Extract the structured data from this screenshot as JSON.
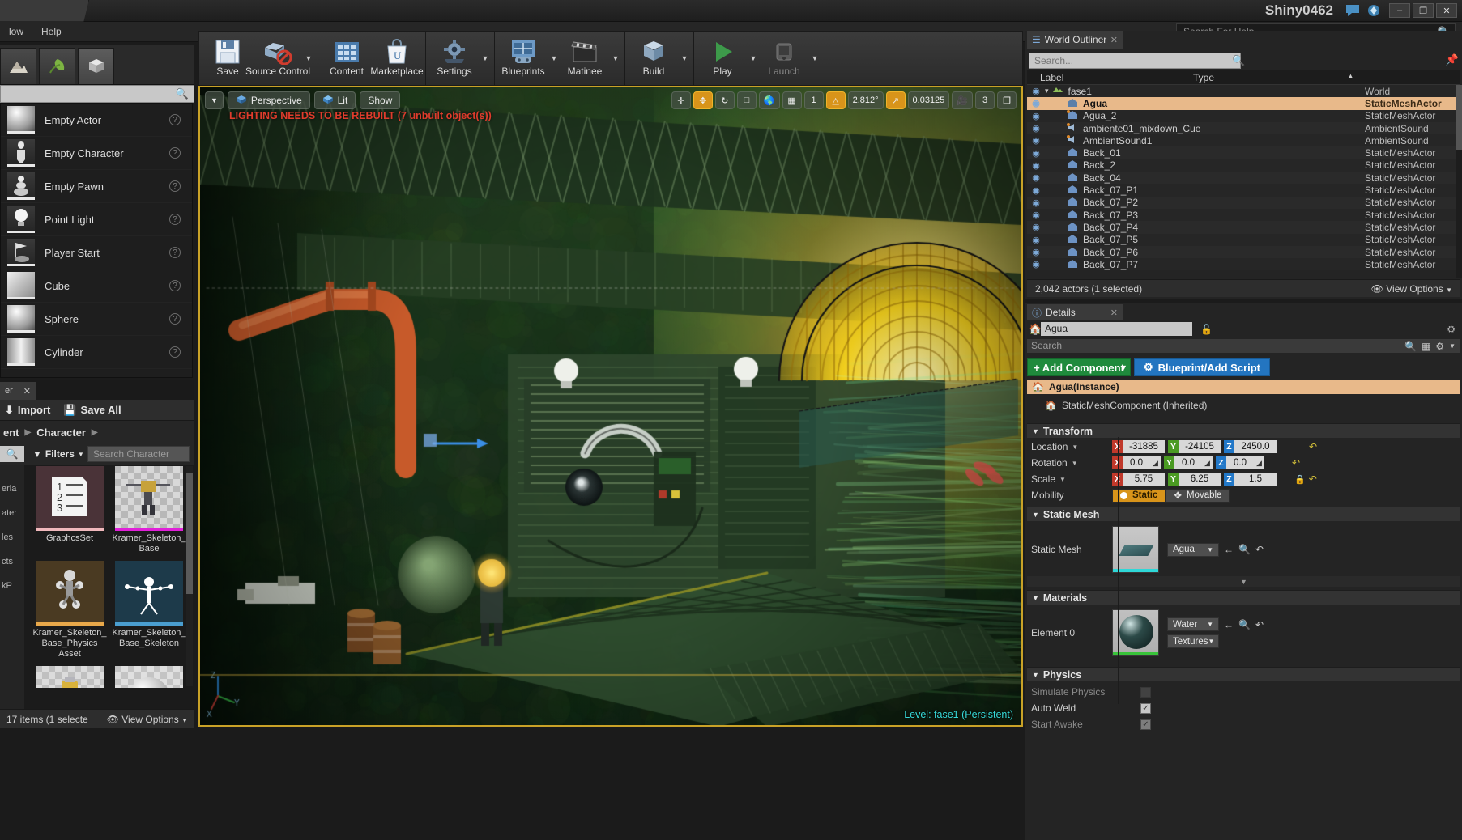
{
  "titlebar": {
    "tab_label": "",
    "project_title": "Shiny0462",
    "minimize": "–",
    "maximize": "❐",
    "close": "✕"
  },
  "menubar": {
    "items": [
      "low",
      "Help"
    ],
    "help_search_placeholder": "Search For Help"
  },
  "modes": {
    "search_placeholder": "",
    "place_items": [
      {
        "label": "Empty Actor",
        "icon": "sphere-icon"
      },
      {
        "label": "Empty Character",
        "icon": "character-icon"
      },
      {
        "label": "Empty Pawn",
        "icon": "pawn-icon"
      },
      {
        "label": "Point Light",
        "icon": "bulb-icon"
      },
      {
        "label": "Player Start",
        "icon": "flag-icon"
      },
      {
        "label": "Cube",
        "icon": "cube-icon"
      },
      {
        "label": "Sphere",
        "icon": "sphere-icon"
      },
      {
        "label": "Cylinder",
        "icon": "cylinder-icon"
      }
    ]
  },
  "content_browser": {
    "tab_label": "er",
    "tab_close": "✕",
    "import_label": "Import",
    "save_all_label": "Save All",
    "breadcrumb": [
      "ent",
      "Character"
    ],
    "filters_label": "Filters",
    "search_placeholder": "Search Character",
    "status_count": "17 items (1 selecte",
    "view_options": "View Options",
    "side_labels": [
      "eria",
      "ater",
      "les",
      "cts",
      "kP"
    ],
    "assets": [
      {
        "name": "GraphcsSet",
        "bg": "#4a3338",
        "bar": "#f0b8bc",
        "kind": "doc"
      },
      {
        "name": "Kramer_Skeleton_Base",
        "bg": "#c9c9c9",
        "bar": "#e020d8",
        "kind": "mesh"
      },
      {
        "name": "Kramer_Skeleton_Base_Physics Asset",
        "bg": "#4a3a22",
        "bar": "#e8a84a",
        "kind": "physics"
      },
      {
        "name": "Kramer_Skeleton_Base_Skeleton",
        "bg": "#1d3a4a",
        "bar": "#4a9ed0",
        "kind": "skeleton"
      },
      {
        "name": "",
        "bg": "#c2c2c2",
        "bar": "#c8c8c8",
        "kind": "mesh2"
      },
      {
        "name": "",
        "bg": "#cfcfcf",
        "bar": "#c8c8c8",
        "kind": "sphere"
      }
    ]
  },
  "toolbar": {
    "groups": [
      {
        "buttons": [
          {
            "label": "Save",
            "icon": "save-icon",
            "caret": false
          },
          {
            "label": "Source Control",
            "icon": "source-control-icon",
            "caret": true
          }
        ]
      },
      {
        "buttons": [
          {
            "label": "Content",
            "icon": "content-icon",
            "caret": false
          },
          {
            "label": "Marketplace",
            "icon": "marketplace-icon",
            "caret": false
          }
        ]
      },
      {
        "buttons": [
          {
            "label": "Settings",
            "icon": "settings-icon",
            "caret": true
          }
        ]
      },
      {
        "buttons": [
          {
            "label": "Blueprints",
            "icon": "blueprints-icon",
            "caret": true
          },
          {
            "label": "Matinee",
            "icon": "matinee-icon",
            "caret": true
          }
        ]
      },
      {
        "buttons": [
          {
            "label": "Build",
            "icon": "build-icon",
            "caret": true
          }
        ]
      },
      {
        "buttons": [
          {
            "label": "Play",
            "icon": "play-icon",
            "caret": true
          },
          {
            "label": "Launch",
            "icon": "launch-icon",
            "caret": true
          }
        ]
      }
    ]
  },
  "viewport": {
    "perspective_label": "Perspective",
    "lit_label": "Lit",
    "show_label": "Show",
    "warning": "LIGHTING NEEDS TO BE REBUILT (7 unbuilt object(s))",
    "level_status": "Level:  fase1 (Persistent)",
    "grid_value": "1",
    "rotation_snap": "2.812°",
    "scale_snap": "0.03125",
    "camera_speed": "3",
    "right_icons": [
      "move-icon",
      "rotate-icon",
      "scale-icon",
      "world-icon",
      "grid-icon",
      "angle-icon",
      "speed-icon",
      "maximize-icon"
    ]
  },
  "world_outliner": {
    "tab_label": "World Outliner",
    "tab_close": "✕",
    "search_placeholder": "Search...",
    "columns": {
      "label": "Label",
      "type": "Type"
    },
    "rows": [
      {
        "label": "fase1",
        "type": "World",
        "indent": 0,
        "selected": false,
        "icon": "world-icon"
      },
      {
        "label": "Agua",
        "type": "StaticMeshActor",
        "indent": 1,
        "selected": true,
        "icon": "staticmesh-icon"
      },
      {
        "label": "Agua_2",
        "type": "StaticMeshActor",
        "indent": 1,
        "selected": false,
        "icon": "staticmesh-bp-icon"
      },
      {
        "label": "ambiente01_mixdown_Cue",
        "type": "AmbientSound",
        "indent": 1,
        "selected": false,
        "icon": "sound-icon"
      },
      {
        "label": "AmbientSound1",
        "type": "AmbientSound",
        "indent": 1,
        "selected": false,
        "icon": "sound-icon"
      },
      {
        "label": "Back_01",
        "type": "StaticMeshActor",
        "indent": 1,
        "selected": false,
        "icon": "staticmesh-icon"
      },
      {
        "label": "Back_2",
        "type": "StaticMeshActor",
        "indent": 1,
        "selected": false,
        "icon": "staticmesh-icon"
      },
      {
        "label": "Back_04",
        "type": "StaticMeshActor",
        "indent": 1,
        "selected": false,
        "icon": "staticmesh-icon"
      },
      {
        "label": "Back_07_P1",
        "type": "StaticMeshActor",
        "indent": 1,
        "selected": false,
        "icon": "staticmesh-icon"
      },
      {
        "label": "Back_07_P2",
        "type": "StaticMeshActor",
        "indent": 1,
        "selected": false,
        "icon": "staticmesh-icon"
      },
      {
        "label": "Back_07_P3",
        "type": "StaticMeshActor",
        "indent": 1,
        "selected": false,
        "icon": "staticmesh-icon"
      },
      {
        "label": "Back_07_P4",
        "type": "StaticMeshActor",
        "indent": 1,
        "selected": false,
        "icon": "staticmesh-icon"
      },
      {
        "label": "Back_07_P5",
        "type": "StaticMeshActor",
        "indent": 1,
        "selected": false,
        "icon": "staticmesh-icon"
      },
      {
        "label": "Back_07_P6",
        "type": "StaticMeshActor",
        "indent": 1,
        "selected": false,
        "icon": "staticmesh-icon"
      },
      {
        "label": "Back_07_P7",
        "type": "StaticMeshActor",
        "indent": 1,
        "selected": false,
        "icon": "staticmesh-icon"
      }
    ],
    "footer_count": "2,042 actors (1 selected)",
    "view_options": "View Options"
  },
  "details": {
    "tab_label": "Details",
    "tab_close": "✕",
    "actor_name": "Agua",
    "search_placeholder": "Search",
    "add_component_label": "+ Add Component",
    "blueprint_label": "Blueprint/Add Script",
    "component_root": "Agua(Instance)",
    "component_child": "StaticMeshComponent (Inherited)",
    "sections": {
      "transform": "Transform",
      "static_mesh": "Static Mesh",
      "materials": "Materials",
      "physics": "Physics"
    },
    "transform": {
      "location_label": "Location",
      "location": {
        "x": "-31885",
        "y": "-24105",
        "z": "2450.0"
      },
      "rotation_label": "Rotation",
      "rotation": {
        "x": "0.0",
        "y": "0.0",
        "z": "0.0"
      },
      "scale_label": "Scale",
      "scale": {
        "x": "5.75",
        "y": "6.25",
        "z": "1.5"
      },
      "mobility_label": "Mobility",
      "mobility_static": "Static",
      "mobility_movable": "Movable",
      "mobility_selected": "Static"
    },
    "static_mesh": {
      "row_label": "Static Mesh",
      "asset_name": "Agua"
    },
    "materials": {
      "element_label": "Element 0",
      "material_name": "Water",
      "textures_label": "Textures"
    },
    "physics": {
      "simulate_label": "Simulate Physics",
      "simulate_checked": false,
      "auto_weld_label": "Auto Weld",
      "auto_weld_checked": true,
      "start_awake_label": "Start Awake",
      "start_awake_checked": true
    }
  },
  "colors": {
    "accent_orange": "#d8941a",
    "select_peach": "#e8b98a",
    "green_button": "#1f8a3c",
    "blue_button": "#2375c0",
    "warning_red": "#e03c2c",
    "level_cyan": "#36d9d9",
    "viewport_border": "#c9a227"
  }
}
